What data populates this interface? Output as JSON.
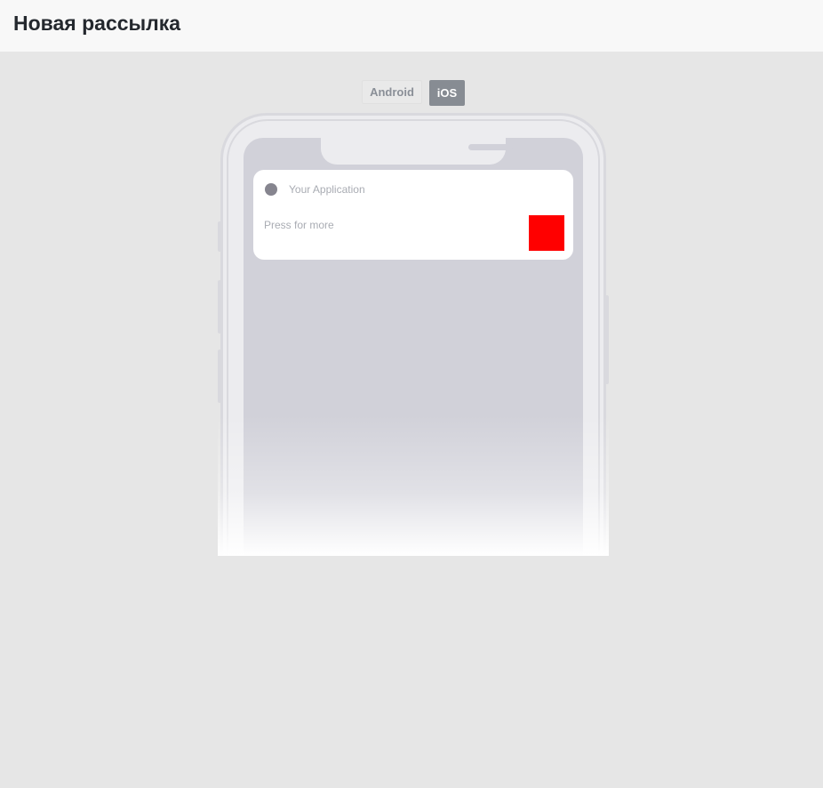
{
  "header": {
    "title": "Новая рассылка"
  },
  "platform_tabs": {
    "android_label": "Android",
    "ios_label": "iOS",
    "selected": "iOS"
  },
  "preview": {
    "notification": {
      "app_name": "Your Application",
      "body": "Press for more",
      "app_icon": "app-icon-circle",
      "image_color": "#ff0000"
    }
  },
  "colors": {
    "background": "#e6e6e6",
    "header_background": "#f8f8f8",
    "tab_active": "#878c93",
    "phone_screen": "#d1d1d9"
  }
}
